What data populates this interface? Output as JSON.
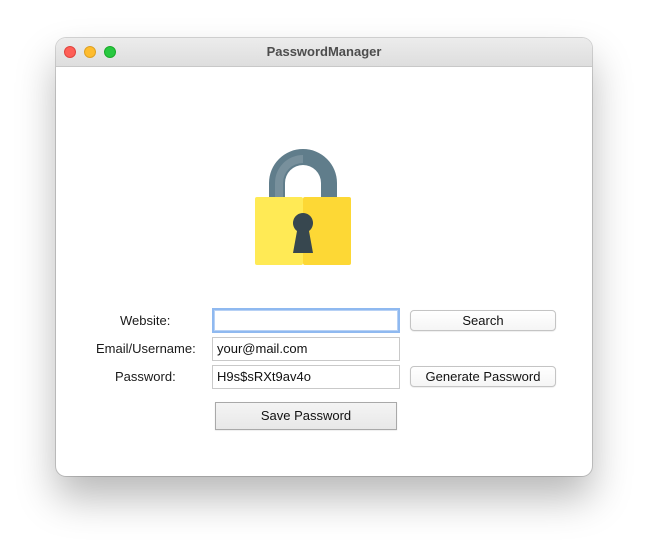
{
  "window": {
    "title": "PasswordManager"
  },
  "logo": {
    "icon": "padlock-icon",
    "colors": {
      "shackle": "#607d8b",
      "body_light": "#ffea55",
      "body_dark": "#fdd835",
      "keyhole": "#37474f"
    }
  },
  "form": {
    "website_label": "Website:",
    "website_value": "",
    "email_label": "Email/Username:",
    "email_value": "your@mail.com",
    "password_label": "Password:",
    "password_value": "H9s$sRXt9av4o"
  },
  "buttons": {
    "search": "Search",
    "generate": "Generate Password",
    "save": "Save Password"
  },
  "colors": {
    "focus_ring": "#8fb9f0"
  }
}
